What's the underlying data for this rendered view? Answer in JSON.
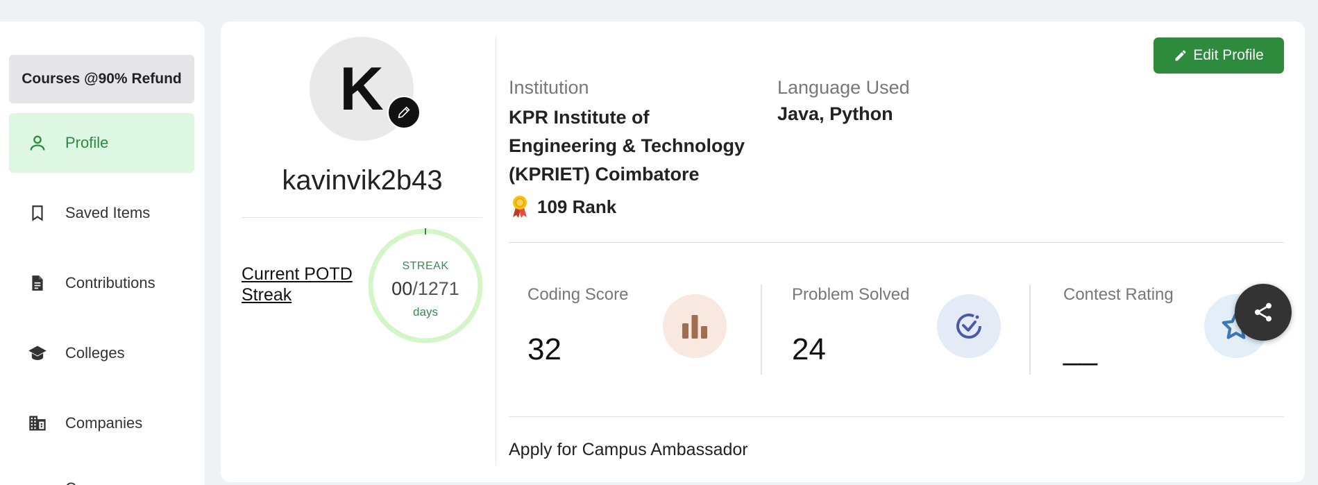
{
  "sidebar": {
    "promo_label": "Courses @90% Refund",
    "items": [
      {
        "label": "Profile",
        "icon": "person-icon",
        "active": true
      },
      {
        "label": "Saved Items",
        "icon": "bookmark-icon"
      },
      {
        "label": "Contributions",
        "icon": "document-icon"
      },
      {
        "label": "Colleges",
        "icon": "graduation-cap-icon"
      },
      {
        "label": "Companies",
        "icon": "building-icon"
      },
      {
        "label": "Campus",
        "icon": "campus-icon"
      }
    ]
  },
  "profile": {
    "avatar_letter": "K",
    "username": "kavinvik2b43",
    "potd_link": "Current POTD Streak",
    "streak": {
      "label": "STREAK",
      "current": "00",
      "separator": "/",
      "max": "1271",
      "unit": "days"
    }
  },
  "details": {
    "edit_button": "Edit Profile",
    "institution_label": "Institution",
    "institution_value": "KPR Institute of Engineering & Technology (KPRIET) Coimbatore",
    "language_label": "Language Used",
    "language_value": "Java, Python",
    "rank_value": "109 Rank"
  },
  "stats": [
    {
      "label": "Coding Score",
      "value": "32",
      "icon": "bar-chart-icon",
      "icon_bg": "#f8e8df",
      "icon_color": "#a06e52"
    },
    {
      "label": "Problem Solved",
      "value": "24",
      "icon": "check-circle-icon",
      "icon_bg": "#e4ebf7",
      "icon_color": "#4b5aa8"
    },
    {
      "label": "Contest Rating",
      "value": "__",
      "icon": "star-icon",
      "icon_bg": "#e2eef8",
      "icon_color": "#3a78b8"
    }
  ],
  "ambassador_link": "Apply for Campus Ambassador",
  "colors": {
    "accent_green": "#2e8b3e",
    "active_bg": "#def7e2",
    "streak_ring": "#d4f5c8"
  }
}
